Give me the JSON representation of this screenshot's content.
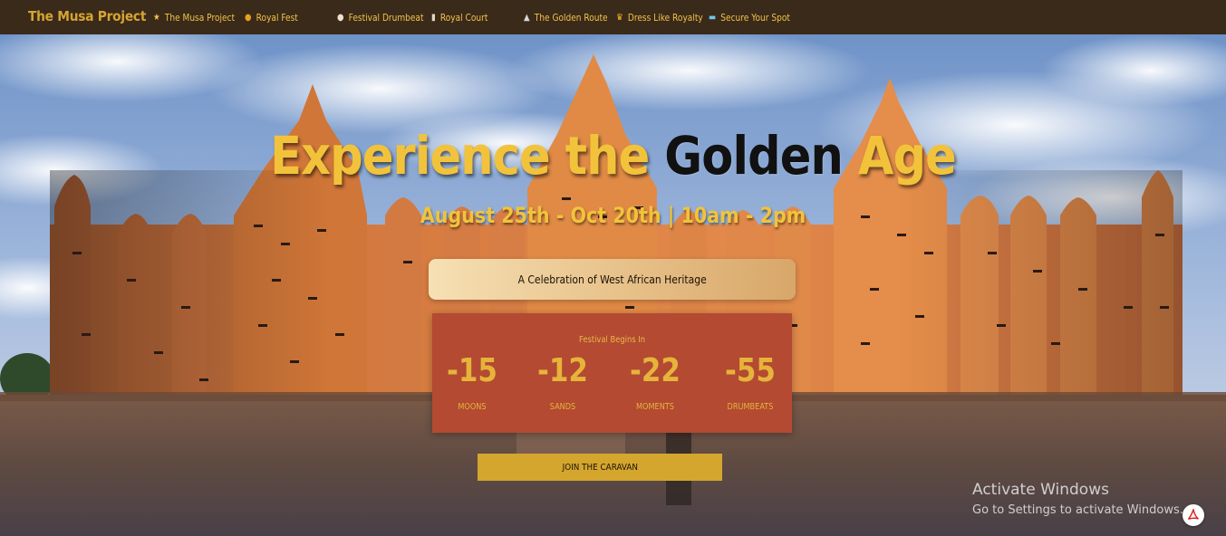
{
  "nav": {
    "brand": "The Musa Project",
    "items": [
      {
        "icon": "star-icon",
        "glyph": "★",
        "label": "The Musa Project"
      },
      {
        "icon": "crown-coin-icon",
        "glyph": "●",
        "label": "Royal Fest"
      },
      {
        "icon": "drum-icon",
        "glyph": "●",
        "label": "Festival Drumbeat"
      },
      {
        "icon": "scroll-icon",
        "glyph": "▮",
        "label": "Royal Court"
      },
      {
        "icon": "museum-icon",
        "glyph": "▲",
        "label": "The Golden Route"
      },
      {
        "icon": "crown-icon",
        "glyph": "♛",
        "label": "Dress Like Royalty"
      },
      {
        "icon": "ticket-icon",
        "glyph": "▬",
        "label": "Secure Your Spot"
      }
    ]
  },
  "hero": {
    "title_part1": "Experience the ",
    "title_part2": "Golden",
    "title_part3": " Age",
    "dates": "August 25th - Oct 20th | 10am - 2pm",
    "tagline": "A Celebration of West African Heritage"
  },
  "countdown": {
    "label": "Festival Begins In",
    "units": [
      {
        "value": "-15",
        "name": "MOONS"
      },
      {
        "value": "-12",
        "name": "SANDS"
      },
      {
        "value": "-22",
        "name": "MOMENTS"
      },
      {
        "value": "-55",
        "name": "DRUMBEATS"
      }
    ]
  },
  "cta": {
    "label": "JOIN THE CARAVAN"
  },
  "watermark": {
    "title": "Activate Windows",
    "subtitle": "Go to Settings to activate Windows."
  },
  "colors": {
    "nav_bg": "#3a2a1a",
    "gold": "#f2c33a",
    "countdown_bg": "#b34a31",
    "cta_bg": "#d4a62e"
  }
}
